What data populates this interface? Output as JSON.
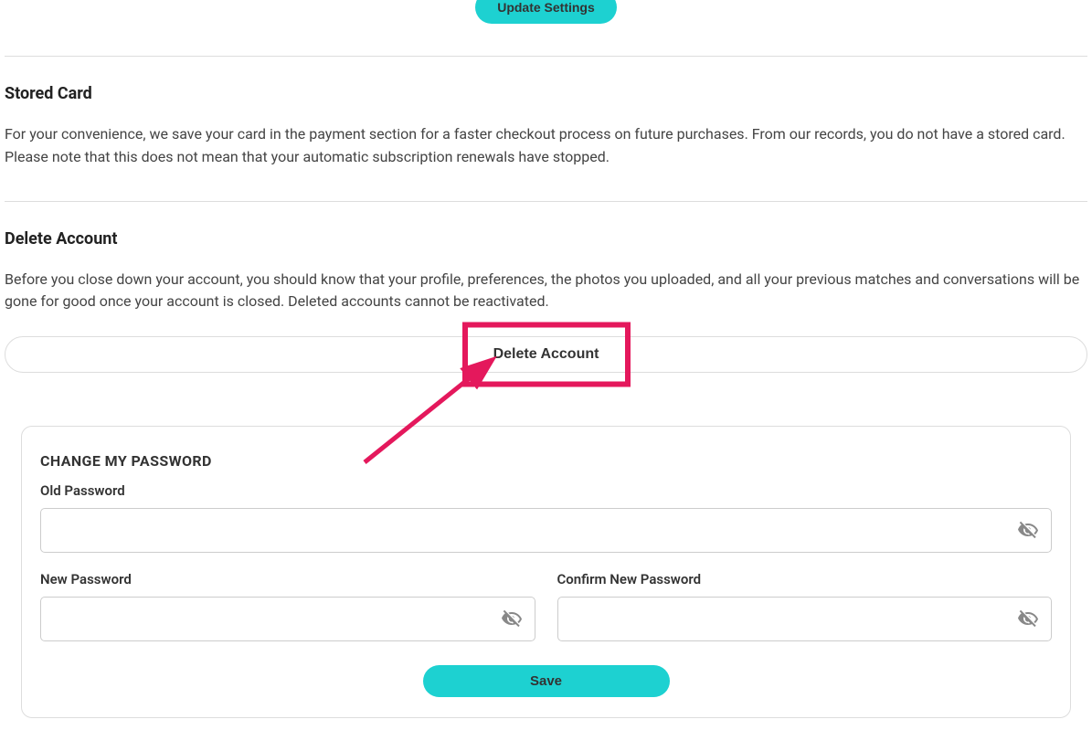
{
  "top": {
    "update_label": "Update Settings"
  },
  "stored_card": {
    "heading": "Stored Card",
    "body": "For your convenience, we save your card in the payment section for a faster checkout process on future purchases. From our records, you do not have a stored card. Please note that this does not mean that your automatic subscription renewals have stopped."
  },
  "delete_account": {
    "heading": "Delete Account",
    "body": "Before you close down your account, you should know that your profile, preferences, the photos you uploaded, and all your previous matches and conversations will be gone for good once your account is closed. Deleted accounts cannot be reactivated.",
    "button_label": "Delete Account"
  },
  "change_password": {
    "heading": "CHANGE MY PASSWORD",
    "old_label": "Old Password",
    "new_label": "New Password",
    "confirm_label": "Confirm New Password",
    "save_label": "Save"
  },
  "colors": {
    "accent": "#1dd1d1",
    "highlight": "#e4185c"
  }
}
